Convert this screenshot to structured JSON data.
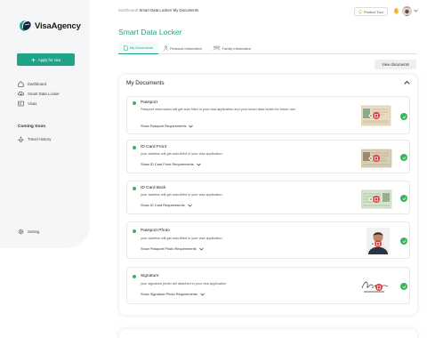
{
  "app": {
    "brand": "VisaAgency",
    "colors": {
      "accent": "#1fa489",
      "success": "#3cb35f"
    }
  },
  "sidebar": {
    "apply_label": "Apply for visa",
    "items": [
      {
        "label": "Dashboard",
        "icon": "home-icon"
      },
      {
        "label": "Smart Data Locker",
        "icon": "cloud-lock-icon"
      },
      {
        "label": "Visas",
        "icon": "passport-icon"
      }
    ],
    "coming_soon": "Coming Soon",
    "travel_history": "Travel History",
    "setting": "Setting"
  },
  "header": {
    "breadcrumb_root": "Dashboard",
    "breadcrumb_rest": "Smart Data Locker/ My Documents",
    "product_tour": "Product Tour"
  },
  "page": {
    "title": "Smart Data Locker",
    "tabs": [
      {
        "label": "My Documents",
        "active": true
      },
      {
        "label": "Personal Information",
        "active": false
      },
      {
        "label": "Family Information",
        "active": false
      }
    ],
    "view_documents": "View documents",
    "section_title": "My Documents"
  },
  "documents": [
    {
      "title": "Passport",
      "desc": "Passport information will get auto filled in your visa application and your smart data locker for future use.",
      "link": "Show Passport Requirements",
      "status": "complete"
    },
    {
      "title": "ID Card Front",
      "desc": "your address will get auto-filled in your visa application",
      "link": "Show ID Card Front Requirements",
      "status": "complete"
    },
    {
      "title": "ID Card Back",
      "desc": "your address will get auto-filled in your visa application",
      "link": "Show ID Card Requirements",
      "status": "complete"
    },
    {
      "title": "Passport Photo",
      "desc": "your address will get auto-filled in your visa application",
      "link": "Show Passport Photo Requirements",
      "status": "complete"
    },
    {
      "title": "Signature",
      "desc": "your signature photo will attached in your visa application",
      "link": "Show Signature Photo Requirements",
      "status": "complete"
    }
  ]
}
